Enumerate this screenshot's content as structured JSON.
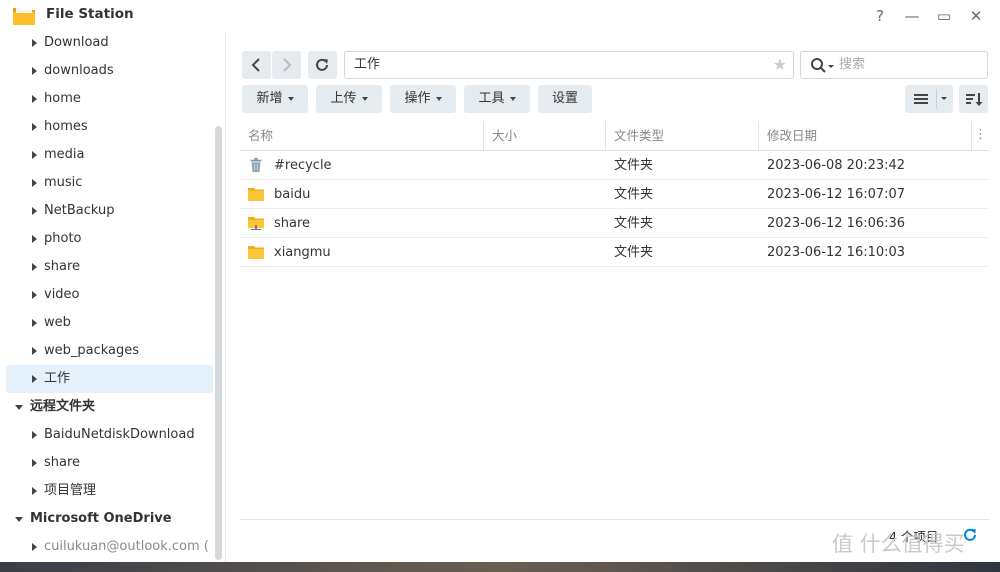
{
  "app": {
    "title": "File Station"
  },
  "window_controls": {
    "help": "?",
    "minimize": "—",
    "maximize": "▭",
    "close": "✕"
  },
  "sidebar": {
    "items": [
      {
        "label": "Download",
        "type": "folder"
      },
      {
        "label": "downloads",
        "type": "folder"
      },
      {
        "label": "home",
        "type": "folder"
      },
      {
        "label": "homes",
        "type": "folder"
      },
      {
        "label": "media",
        "type": "folder"
      },
      {
        "label": "music",
        "type": "folder"
      },
      {
        "label": "NetBackup",
        "type": "folder"
      },
      {
        "label": "photo",
        "type": "folder"
      },
      {
        "label": "share",
        "type": "folder"
      },
      {
        "label": "video",
        "type": "folder"
      },
      {
        "label": "web",
        "type": "folder"
      },
      {
        "label": "web_packages",
        "type": "folder"
      },
      {
        "label": "工作",
        "type": "folder",
        "selected": true
      },
      {
        "label": "远程文件夹",
        "type": "group"
      },
      {
        "label": "BaiduNetdiskDownload",
        "type": "folder"
      },
      {
        "label": "share",
        "type": "folder"
      },
      {
        "label": "项目管理",
        "type": "folder"
      },
      {
        "label": "Microsoft OneDrive",
        "type": "group"
      },
      {
        "label": "cuilukuan@outlook.com (",
        "type": "folder",
        "dim": true
      }
    ]
  },
  "nav": {
    "path": "工作",
    "search_placeholder": "搜索"
  },
  "toolbar": {
    "new": "新增",
    "upload": "上传",
    "action": "操作",
    "tools": "工具",
    "settings": "设置"
  },
  "columns": {
    "name": "名称",
    "size": "大小",
    "type": "文件类型",
    "modified": "修改日期"
  },
  "files": [
    {
      "name": "#recycle",
      "size": "",
      "type": "文件夹",
      "modified": "2023-06-08 20:23:42",
      "icon": "recycle-bin-icon"
    },
    {
      "name": "baidu",
      "size": "",
      "type": "文件夹",
      "modified": "2023-06-12 16:07:07",
      "icon": "folder-icon"
    },
    {
      "name": "share",
      "size": "",
      "type": "文件夹",
      "modified": "2023-06-12 16:06:36",
      "icon": "shared-folder-icon"
    },
    {
      "name": "xiangmu",
      "size": "",
      "type": "文件夹",
      "modified": "2023-06-12 16:10:03",
      "icon": "folder-icon"
    }
  ],
  "status": {
    "count": "4 个项目"
  },
  "watermark": "值 什么值得买",
  "colors": {
    "accent": "#0086e5",
    "folder": "#f8c23a",
    "selected_bg": "#e4f1fb",
    "button_bg": "#e6ebef"
  }
}
